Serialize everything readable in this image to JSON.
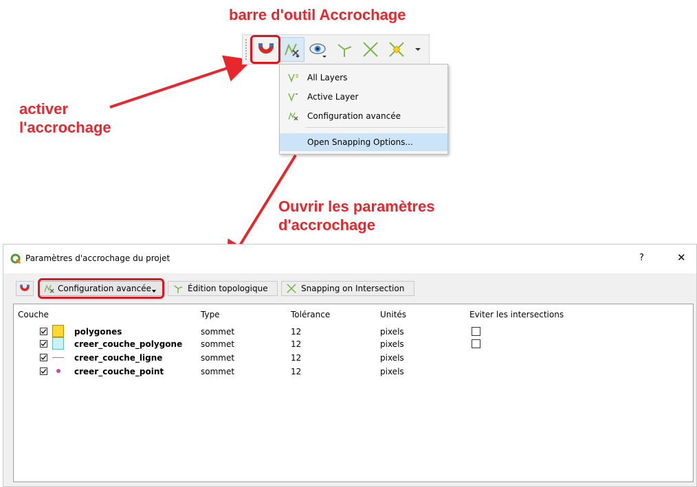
{
  "annotations": {
    "toolbar_title": "barre d'outil Accrochage",
    "activate_line1": "activer",
    "activate_line2": "l'accrochage",
    "open_line1": "Ouvrir les paramètres",
    "open_line2": "d'accrochage"
  },
  "toolbar": {
    "icons": [
      "magnet-icon",
      "advanced-config-icon",
      "eye-icon",
      "topology-icon",
      "intersection-icon",
      "snapping-intersection-icon",
      "dropdown-arrow-icon"
    ]
  },
  "menu": {
    "items": [
      {
        "label": "All Layers",
        "icon": "all-layers-icon"
      },
      {
        "label": "Active Layer",
        "icon": "active-layer-icon"
      },
      {
        "label": "Configuration avancée",
        "icon": "advanced-config-icon"
      },
      {
        "label": "Open Snapping Options...",
        "icon": ""
      }
    ]
  },
  "dialog": {
    "title": "Paramètres d'accrochage du projet",
    "help": "?",
    "close": "✕",
    "toolbar": {
      "advanced": "Configuration avancée",
      "topology": "Édition topologique",
      "intersection": "Snapping on Intersection"
    },
    "columns": [
      "Couche",
      "Type",
      "Tolérance",
      "Unités",
      "Eviter les intersections"
    ],
    "layers": [
      {
        "name": "polygones",
        "type": "sommet",
        "tolerance": "12",
        "units": "pixels",
        "symbol": "polygon-yellow",
        "checked": true,
        "avoid": true
      },
      {
        "name": "creer_couche_polygone",
        "type": "sommet",
        "tolerance": "12",
        "units": "pixels",
        "symbol": "polygon-cyan",
        "checked": true,
        "avoid": true
      },
      {
        "name": "creer_couche_ligne",
        "type": "sommet",
        "tolerance": "12",
        "units": "pixels",
        "symbol": "line",
        "checked": true,
        "avoid": false
      },
      {
        "name": "creer_couche_point",
        "type": "sommet",
        "tolerance": "12",
        "units": "pixels",
        "symbol": "point",
        "checked": true,
        "avoid": false
      }
    ]
  },
  "colors": {
    "annotation_red": "#e8262b",
    "highlight_blue": "#cce4f7",
    "polygon_yellow": "#ffd92e",
    "polygon_cyan": "#c9f2f5",
    "point_magenta": "#c44ab8",
    "line_purple": "#9a7bb0"
  }
}
